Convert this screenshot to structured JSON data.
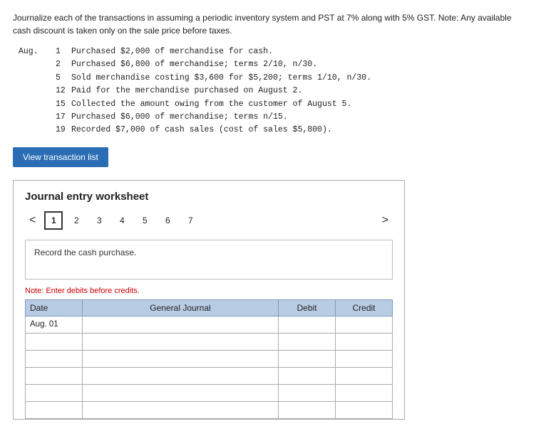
{
  "intro": {
    "line1": "Journalize each of the transactions in assuming a periodic inventory system and PST at 7% along with 5% GST. Note: Any available",
    "line2": "cash discount is taken only on the sale price before taxes."
  },
  "transactions": {
    "month": "Aug.",
    "items": [
      {
        "num": "1",
        "text": "Purchased $2,000 of merchandise for cash."
      },
      {
        "num": "2",
        "text": "Purchased $6,800 of merchandise; terms 2/10, n/30."
      },
      {
        "num": "5",
        "text": "Sold merchandise costing $3,600 for $5,200; terms 1/10, n/30."
      },
      {
        "num": "12",
        "text": "Paid for the merchandise purchased on August 2."
      },
      {
        "num": "15",
        "text": "Collected the amount owing from the customer of August 5."
      },
      {
        "num": "17",
        "text": "Purchased $6,000 of merchandise; terms n/15."
      },
      {
        "num": "19",
        "text": "Recorded $7,000 of cash sales (cost of sales $5,800)."
      }
    ]
  },
  "button": {
    "label": "View transaction list"
  },
  "worksheet": {
    "title": "Journal entry worksheet",
    "pages": [
      "1",
      "2",
      "3",
      "4",
      "5",
      "6",
      "7"
    ],
    "active_page": "1",
    "record_instruction": "Record the cash purchase.",
    "note": "Note: Enter debits before credits.",
    "table": {
      "headers": [
        "Date",
        "General Journal",
        "Debit",
        "Credit"
      ],
      "rows": [
        {
          "date": "Aug. 01",
          "gj": "",
          "debit": "",
          "credit": ""
        },
        {
          "date": "",
          "gj": "",
          "debit": "",
          "credit": ""
        },
        {
          "date": "",
          "gj": "",
          "debit": "",
          "credit": ""
        },
        {
          "date": "",
          "gj": "",
          "debit": "",
          "credit": ""
        },
        {
          "date": "",
          "gj": "",
          "debit": "",
          "credit": ""
        },
        {
          "date": "",
          "gj": "",
          "debit": "",
          "credit": ""
        }
      ]
    }
  },
  "nav": {
    "prev_arrow": "<",
    "next_arrow": ">"
  }
}
